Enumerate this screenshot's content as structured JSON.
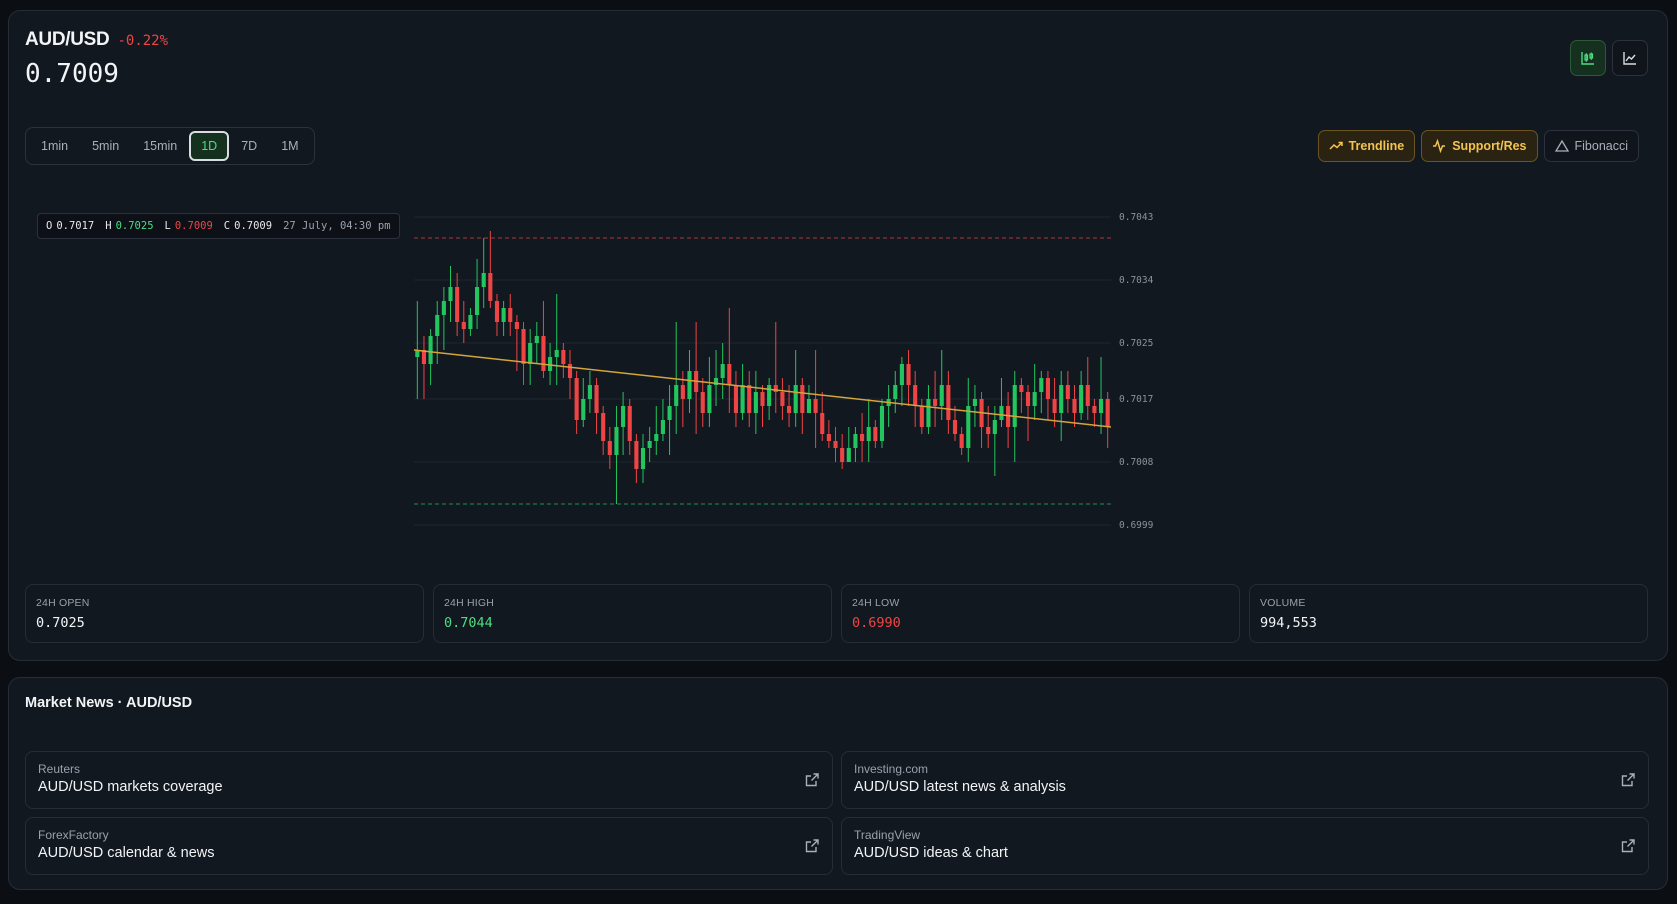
{
  "header": {
    "symbol": "AUD/USD",
    "change": "-0.22%",
    "price": "0.7009"
  },
  "view_toggles": [
    {
      "icon": "candlestick-chart-icon",
      "active": true
    },
    {
      "icon": "line-chart-icon",
      "active": false
    }
  ],
  "timeframes": [
    "1min",
    "5min",
    "15min",
    "1D",
    "7D",
    "1M"
  ],
  "active_timeframe": "1D",
  "tools": {
    "trendline": "Trendline",
    "support_res": "Support/Res",
    "fibonacci": "Fibonacci"
  },
  "ohlc": {
    "o_label": "O",
    "o": "0.7017",
    "h_label": "H",
    "h": "0.7025",
    "l_label": "L",
    "l": "0.7009",
    "c_label": "C",
    "c": "0.7009",
    "time": "27 July, 04:30 pm"
  },
  "colors": {
    "up": "#22c55e",
    "down": "#ef4444",
    "trendline": "#d4a63a",
    "resistance": "#ef4444",
    "support": "#22c55e",
    "accent_active": "#4ade80"
  },
  "chart_data": {
    "type": "candlestick",
    "y_ticks": [
      "0.7043",
      "0.7034",
      "0.7025",
      "0.7017",
      "0.7008",
      "0.6999"
    ],
    "ylim": [
      0.6999,
      0.7043
    ],
    "resistance": 0.704,
    "support": 0.7002,
    "trendline": {
      "start": 0.7024,
      "end": 0.7013
    },
    "grid": true,
    "candles": [
      [
        0.7023,
        0.7024,
        0.7031,
        0.7017
      ],
      [
        0.7024,
        0.7022,
        0.7026,
        0.7017
      ],
      [
        0.7022,
        0.7026,
        0.7027,
        0.7019
      ],
      [
        0.7026,
        0.7029,
        0.7031,
        0.7022
      ],
      [
        0.7029,
        0.7031,
        0.7033,
        0.7024
      ],
      [
        0.7031,
        0.7033,
        0.7036,
        0.7028
      ],
      [
        0.7033,
        0.7028,
        0.7035,
        0.7026
      ],
      [
        0.7028,
        0.7027,
        0.7031,
        0.7025
      ],
      [
        0.7027,
        0.7029,
        0.703,
        0.7026
      ],
      [
        0.7029,
        0.7033,
        0.7037,
        0.7027
      ],
      [
        0.7033,
        0.7035,
        0.704,
        0.703
      ],
      [
        0.7035,
        0.7031,
        0.7041,
        0.703
      ],
      [
        0.7031,
        0.7028,
        0.7032,
        0.7026
      ],
      [
        0.7028,
        0.703,
        0.7031,
        0.7026
      ],
      [
        0.703,
        0.7028,
        0.7032,
        0.7026
      ],
      [
        0.7028,
        0.7027,
        0.7029,
        0.7021
      ],
      [
        0.7027,
        0.7022,
        0.7028,
        0.7019
      ],
      [
        0.7022,
        0.7025,
        0.7027,
        0.7019
      ],
      [
        0.7025,
        0.7026,
        0.7028,
        0.7022
      ],
      [
        0.7026,
        0.7021,
        0.7031,
        0.702
      ],
      [
        0.7021,
        0.7023,
        0.7025,
        0.7019
      ],
      [
        0.7023,
        0.7024,
        0.7032,
        0.7019
      ],
      [
        0.7024,
        0.7022,
        0.7025,
        0.702
      ],
      [
        0.7022,
        0.702,
        0.7024,
        0.7017
      ],
      [
        0.702,
        0.7014,
        0.7021,
        0.7012
      ],
      [
        0.7014,
        0.7017,
        0.702,
        0.7013
      ],
      [
        0.7017,
        0.7019,
        0.7021,
        0.7015
      ],
      [
        0.7019,
        0.7015,
        0.702,
        0.7012
      ],
      [
        0.7015,
        0.7011,
        0.7016,
        0.7009
      ],
      [
        0.7011,
        0.7009,
        0.7013,
        0.7007
      ],
      [
        0.7009,
        0.7013,
        0.7016,
        0.7002
      ],
      [
        0.7013,
        0.7016,
        0.7018,
        0.7009
      ],
      [
        0.7016,
        0.7011,
        0.7017,
        0.7009
      ],
      [
        0.7011,
        0.7007,
        0.7012,
        0.7005
      ],
      [
        0.7007,
        0.701,
        0.7012,
        0.7005
      ],
      [
        0.701,
        0.7011,
        0.7013,
        0.7008
      ],
      [
        0.7011,
        0.7012,
        0.7016,
        0.7009
      ],
      [
        0.7012,
        0.7014,
        0.7017,
        0.7011
      ],
      [
        0.7014,
        0.7016,
        0.7019,
        0.7009
      ],
      [
        0.7016,
        0.7019,
        0.7028,
        0.7012
      ],
      [
        0.7019,
        0.7017,
        0.7021,
        0.7013
      ],
      [
        0.7017,
        0.7021,
        0.7024,
        0.7015
      ],
      [
        0.7021,
        0.7018,
        0.7028,
        0.7012
      ],
      [
        0.7018,
        0.7015,
        0.702,
        0.7013
      ],
      [
        0.7015,
        0.7019,
        0.7023,
        0.7013
      ],
      [
        0.7019,
        0.702,
        0.7024,
        0.7016
      ],
      [
        0.702,
        0.7022,
        0.7025,
        0.7017
      ],
      [
        0.7022,
        0.7019,
        0.703,
        0.7015
      ],
      [
        0.7019,
        0.7015,
        0.7021,
        0.7013
      ],
      [
        0.7015,
        0.7019,
        0.7022,
        0.7014
      ],
      [
        0.7019,
        0.7015,
        0.7021,
        0.7013
      ],
      [
        0.7015,
        0.7018,
        0.7021,
        0.7012
      ],
      [
        0.7018,
        0.7016,
        0.7019,
        0.7013
      ],
      [
        0.7016,
        0.7019,
        0.702,
        0.7014
      ],
      [
        0.7019,
        0.7018,
        0.7028,
        0.7015
      ],
      [
        0.7018,
        0.7016,
        0.702,
        0.7014
      ],
      [
        0.7016,
        0.7015,
        0.7019,
        0.7013
      ],
      [
        0.7015,
        0.7019,
        0.7024,
        0.7013
      ],
      [
        0.7019,
        0.7015,
        0.702,
        0.7012
      ],
      [
        0.7015,
        0.7017,
        0.7019,
        0.7015
      ],
      [
        0.7017,
        0.7015,
        0.7024,
        0.701
      ],
      [
        0.7015,
        0.7012,
        0.7018,
        0.7011
      ],
      [
        0.7012,
        0.7011,
        0.7014,
        0.701
      ],
      [
        0.7011,
        0.701,
        0.7013,
        0.7008
      ],
      [
        0.701,
        0.7008,
        0.7012,
        0.7007
      ],
      [
        0.7008,
        0.701,
        0.7013,
        0.7008
      ],
      [
        0.701,
        0.7012,
        0.7013,
        0.7008
      ],
      [
        0.7012,
        0.7011,
        0.7015,
        0.7008
      ],
      [
        0.7011,
        0.7013,
        0.7017,
        0.7008
      ],
      [
        0.7013,
        0.7011,
        0.7014,
        0.701
      ],
      [
        0.7011,
        0.7016,
        0.7017,
        0.701
      ],
      [
        0.7016,
        0.7017,
        0.7019,
        0.7013
      ],
      [
        0.7017,
        0.7019,
        0.7021,
        0.7015
      ],
      [
        0.7019,
        0.7022,
        0.7023,
        0.7016
      ],
      [
        0.7022,
        0.7019,
        0.7024,
        0.7016
      ],
      [
        0.7019,
        0.7016,
        0.7021,
        0.7013
      ],
      [
        0.7016,
        0.7013,
        0.7017,
        0.7012
      ],
      [
        0.7013,
        0.7017,
        0.7019,
        0.7012
      ],
      [
        0.7017,
        0.7016,
        0.7021,
        0.7013
      ],
      [
        0.7016,
        0.7019,
        0.7024,
        0.7014
      ],
      [
        0.7019,
        0.7014,
        0.7021,
        0.7012
      ],
      [
        0.7014,
        0.7012,
        0.7016,
        0.7011
      ],
      [
        0.7012,
        0.701,
        0.7013,
        0.7009
      ],
      [
        0.701,
        0.7016,
        0.702,
        0.7008
      ],
      [
        0.7016,
        0.7017,
        0.7019,
        0.7013
      ],
      [
        0.7017,
        0.7013,
        0.7018,
        0.701
      ],
      [
        0.7013,
        0.7012,
        0.7016,
        0.701
      ],
      [
        0.7012,
        0.7014,
        0.7016,
        0.7006
      ],
      [
        0.7014,
        0.7016,
        0.702,
        0.7013
      ],
      [
        0.7016,
        0.7013,
        0.7018,
        0.701
      ],
      [
        0.7013,
        0.7019,
        0.7021,
        0.7008
      ],
      [
        0.7019,
        0.7018,
        0.702,
        0.7015
      ],
      [
        0.7018,
        0.7016,
        0.7019,
        0.7011
      ],
      [
        0.7016,
        0.7018,
        0.7022,
        0.7014
      ],
      [
        0.7018,
        0.702,
        0.7021,
        0.7015
      ],
      [
        0.702,
        0.7017,
        0.7021,
        0.7014
      ],
      [
        0.7017,
        0.7015,
        0.702,
        0.7013
      ],
      [
        0.7015,
        0.7019,
        0.7021,
        0.7011
      ],
      [
        0.7019,
        0.7017,
        0.7021,
        0.7015
      ],
      [
        0.7017,
        0.7015,
        0.7019,
        0.7013
      ],
      [
        0.7015,
        0.7019,
        0.7021,
        0.7014
      ],
      [
        0.7019,
        0.7016,
        0.7023,
        0.7014
      ],
      [
        0.7016,
        0.7015,
        0.7017,
        0.7013
      ],
      [
        0.7015,
        0.7017,
        0.7023,
        0.7012
      ],
      [
        0.7017,
        0.7013,
        0.7018,
        0.701
      ]
    ]
  },
  "stats": [
    {
      "label": "24H OPEN",
      "value": "0.7025",
      "tone": ""
    },
    {
      "label": "24H HIGH",
      "value": "0.7044",
      "tone": "g"
    },
    {
      "label": "24H LOW",
      "value": "0.6990",
      "tone": "r"
    },
    {
      "label": "VOLUME",
      "value": "994,553",
      "tone": ""
    }
  ],
  "news": {
    "title": "Market News · AUD/USD",
    "items": [
      {
        "source": "Reuters",
        "headline": "AUD/USD markets coverage"
      },
      {
        "source": "Investing.com",
        "headline": "AUD/USD latest news & analysis"
      },
      {
        "source": "ForexFactory",
        "headline": "AUD/USD calendar & news"
      },
      {
        "source": "TradingView",
        "headline": "AUD/USD ideas & chart"
      }
    ]
  }
}
